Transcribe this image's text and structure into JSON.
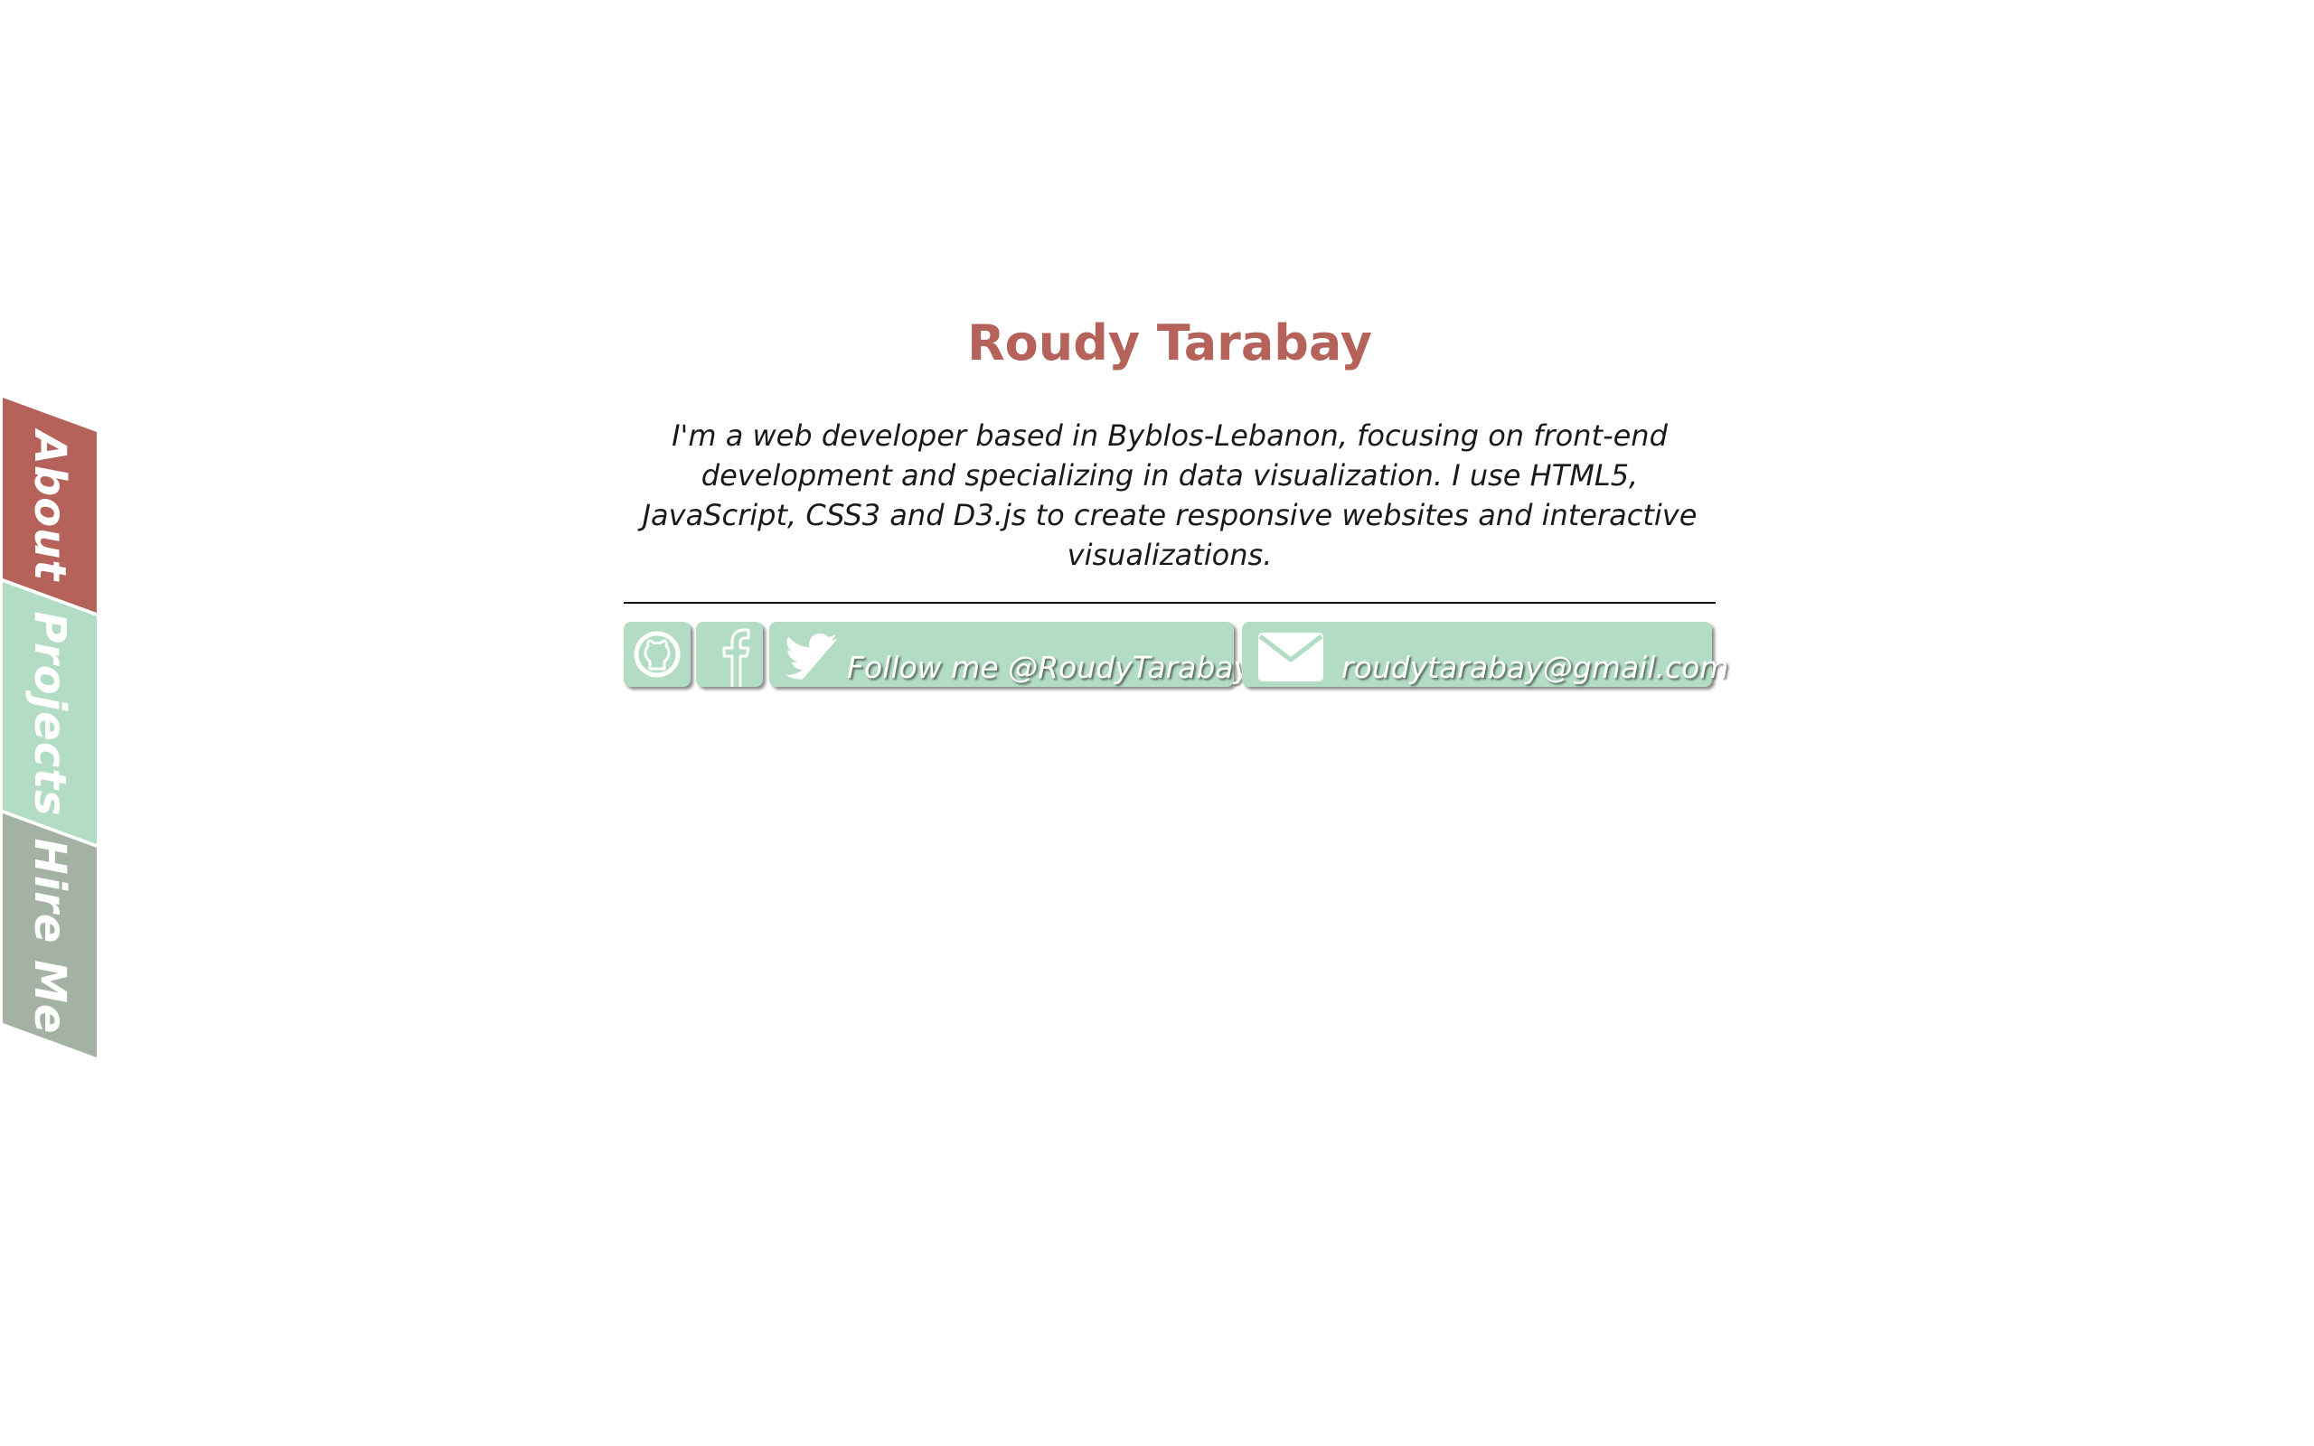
{
  "nav": {
    "items": [
      {
        "label": "About",
        "color": "#b5625a"
      },
      {
        "label": "Projects",
        "color": "#b3dcc4"
      },
      {
        "label": "Hire Me",
        "color": "#a4b2a4"
      }
    ]
  },
  "profile": {
    "name": "Roudy Tarabay",
    "name_color": "#b5625a",
    "bio": "I'm a web developer based in Byblos-Lebanon, focusing on front-end development and specializing in data visualization. I use HTML5, JavaScript, CSS3 and D3.js to create responsive websites and interactive visualizations."
  },
  "social": {
    "button_color": "#b3dcc4",
    "github": {
      "icon": "github-icon"
    },
    "facebook": {
      "icon": "facebook-icon"
    },
    "twitter": {
      "icon": "twitter-icon",
      "label": "Follow me @RoudyTarabay"
    },
    "email": {
      "icon": "envelope-icon",
      "label": "roudytarabay@gmail.com"
    }
  }
}
